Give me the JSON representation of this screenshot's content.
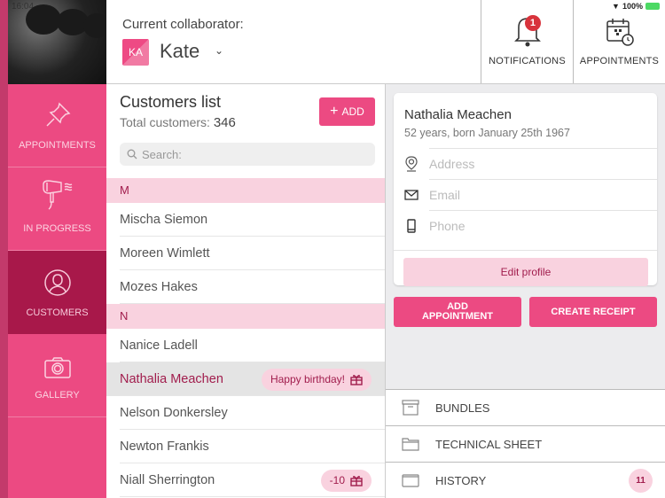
{
  "status_bar": {
    "time": "16:04",
    "battery": "100%"
  },
  "header": {
    "collaborator_label": "Current collaborator:",
    "collaborator_initials": "KA",
    "collaborator_name": "Kate",
    "notifications_label": "NOTIFICATIONS",
    "notifications_count": "1",
    "appointments_label": "APPOINTMENTS"
  },
  "sidebar": {
    "items": [
      {
        "label": "APPOINTMENTS",
        "icon": "pushpin-icon"
      },
      {
        "label": "IN PROGRESS",
        "icon": "hair-dryer-icon"
      },
      {
        "label": "CUSTOMERS",
        "icon": "user-icon",
        "active": true
      },
      {
        "label": "GALLERY",
        "icon": "camera-icon"
      }
    ]
  },
  "customers": {
    "title": "Customers list",
    "total_label": "Total customers:",
    "total_value": "346",
    "add_label": "ADD",
    "search_placeholder": "Search:",
    "sections": [
      {
        "letter": "M",
        "rows": [
          {
            "name": "Mischa Siemon"
          },
          {
            "name": "Moreen Wimlett"
          },
          {
            "name": "Mozes Hakes"
          }
        ]
      },
      {
        "letter": "N",
        "rows": [
          {
            "name": "Nanice Ladell"
          },
          {
            "name": "Nathalia Meachen",
            "badge": "Happy birthday!",
            "selected": true
          },
          {
            "name": "Nelson Donkersley"
          },
          {
            "name": "Newton Frankis"
          },
          {
            "name": "Niall Sherrington",
            "badge": "-10"
          }
        ]
      }
    ]
  },
  "detail": {
    "name": "Nathalia Meachen",
    "subtitle": "52 years, born January 25th 1967",
    "address_placeholder": "Address",
    "email_placeholder": "Email",
    "phone_placeholder": "Phone",
    "edit_label": "Edit profile",
    "add_appointment_line1": "ADD",
    "add_appointment_line2": "APPOINTMENT",
    "create_receipt_label": "CREATE RECEIPT"
  },
  "menu": {
    "bundles": "BUNDLES",
    "technical_sheet": "TECHNICAL SHEET",
    "history": "HISTORY",
    "history_count": "11"
  },
  "colors": {
    "accent": "#ec4a82",
    "accent_dark": "#a8184a",
    "accent_light": "#f9d2df"
  }
}
